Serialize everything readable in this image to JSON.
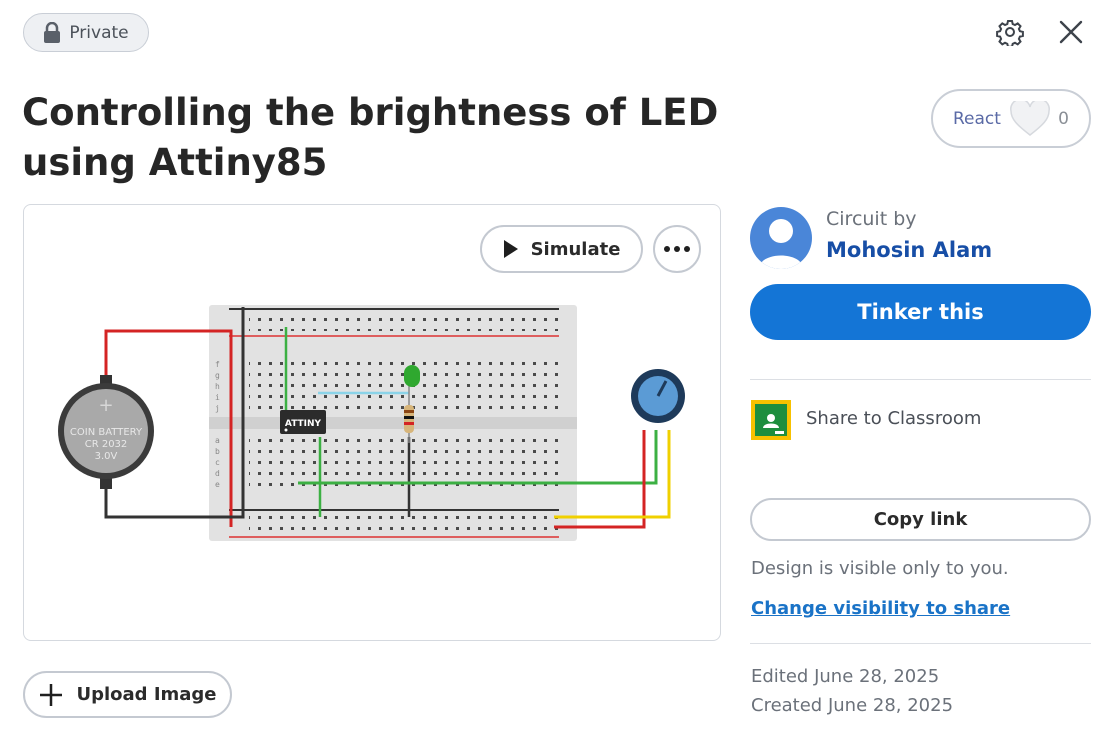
{
  "header": {
    "visibility_badge": "Private",
    "settings_icon": "gear-icon",
    "close_icon": "close-icon"
  },
  "title": "Controlling the brightness of LED using Attiny85",
  "react": {
    "label": "React",
    "count": "0",
    "icon": "heart-icon"
  },
  "canvas": {
    "simulate_label": "Simulate",
    "more_icon": "more-icon",
    "battery_text": [
      "COIN BATTERY",
      "CR 2032",
      "3.0V"
    ],
    "chip_label": "ATTINY",
    "row_letters_top": [
      "f",
      "g",
      "h",
      "i",
      "j"
    ],
    "row_letters_bottom": [
      "a",
      "b",
      "c",
      "d",
      "e"
    ]
  },
  "upload_label": "Upload Image",
  "author": {
    "caption": "Circuit by",
    "name": "Mohosin Alam"
  },
  "tinker_label": "Tinker this",
  "classroom_label": "Share to Classroom",
  "copy_link_label": "Copy link",
  "visibility_note": "Design is visible only to you.",
  "change_visibility_label": "Change visibility to share",
  "edited": "Edited June 28, 2025",
  "created": "Created June 28, 2025",
  "colors": {
    "accent": "#1475d6",
    "link": "#1a73c7",
    "author": "#174ea6"
  }
}
